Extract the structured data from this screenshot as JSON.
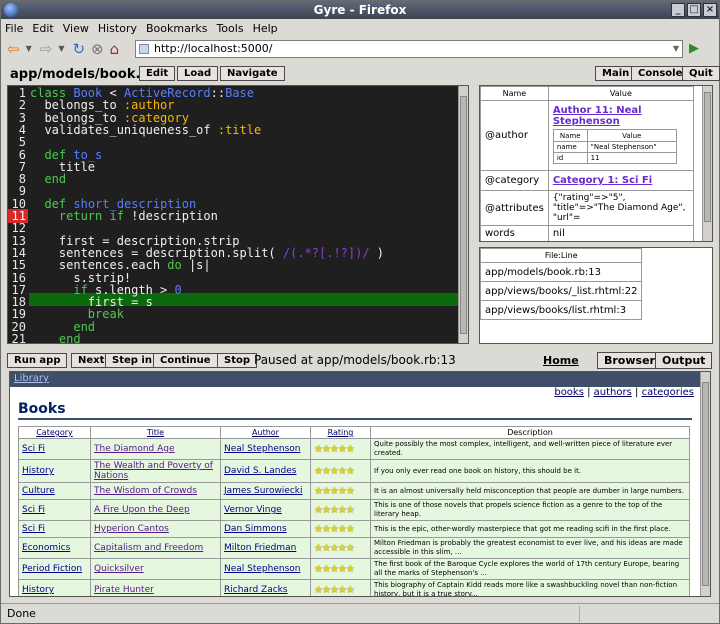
{
  "window": {
    "title": "Gyre - Firefox"
  },
  "menu": [
    "File",
    "Edit",
    "View",
    "History",
    "Bookmarks",
    "Tools",
    "Help"
  ],
  "nav": {
    "url": "http://localhost:5000/"
  },
  "editor": {
    "filename": "app/models/book.rb",
    "edit_label": "Edit",
    "load_label": "Load",
    "navigate_label": "Navigate",
    "main_label": "Main",
    "console_label": "Console",
    "quit_label": "Quit",
    "line_numbers": [
      "1",
      "2",
      "3",
      "4",
      "5",
      "6",
      "7",
      "8",
      "9",
      "10",
      "11",
      "12",
      "13",
      "14",
      "15",
      "16",
      "17",
      "18",
      "19",
      "20",
      "21"
    ],
    "breakpoint_line": 11,
    "current_line": 13
  },
  "variables": {
    "col_name": "Name",
    "col_value": "Value",
    "rows": [
      {
        "name": "@author",
        "value": "Author 11: Neal Stephenson"
      },
      {
        "name": "@category",
        "value": "Category 1: Sci Fi"
      },
      {
        "name": "@attributes",
        "value": "{\"rating\"=>\"5\", \"title\"=>\"The Diamond Age\", \"url\"="
      },
      {
        "name": "words",
        "value": "nil"
      }
    ],
    "author_sub": {
      "col_name": "Name",
      "col_value": "Value",
      "rows": [
        {
          "name": "name",
          "value": "\"Neal Stephenson\""
        },
        {
          "name": "id",
          "value": "11"
        }
      ]
    }
  },
  "stack": {
    "header": "File:Line",
    "frames": [
      "app/models/book.rb:13",
      "app/views/books/_list.rhtml:22",
      "app/views/books/list.rhtml:3"
    ]
  },
  "controls": {
    "run_app": "Run app",
    "next": "Next",
    "step_in": "Step in",
    "continue": "Continue",
    "stop": "Stop",
    "paused_text": "Paused at app/models/book.rb:13",
    "home": "Home",
    "browser": "Browser",
    "output": "Output"
  },
  "page": {
    "library_link": "Library",
    "top_links": [
      "books",
      "authors",
      "categories"
    ],
    "heading": "Books",
    "columns": [
      "Category",
      "Title",
      "Author",
      "Rating",
      "Description"
    ],
    "books": [
      {
        "category": "Sci Fi",
        "title": "The Diamond Age",
        "author": "Neal Stephenson",
        "rating": 5,
        "desc": "Quite possibly the most complex, intelligent, and well-written piece of literature ever created."
      },
      {
        "category": "History",
        "title": "The Wealth and Poverty of Nations",
        "author": "David S. Landes",
        "rating": 5,
        "desc": "If you only ever read one book on history, this should be it."
      },
      {
        "category": "Culture",
        "title": "The Wisdom of Crowds",
        "author": "James Surowiecki",
        "rating": 5,
        "desc": "It is an almost universally held misconception that people are dumber in large numbers."
      },
      {
        "category": "Sci Fi",
        "title": "A Fire Upon the Deep",
        "author": "Vernor Vinge",
        "rating": 5,
        "desc": "This is one of those novels that propels science fiction as a genre to the top of the literary heap."
      },
      {
        "category": "Sci Fi",
        "title": "Hyperion Cantos",
        "author": "Dan Simmons",
        "rating": 5,
        "desc": "This is the epic, other-wordly masterpiece that got me reading scifi in the first place."
      },
      {
        "category": "Economics",
        "title": "Capitalism and Freedom",
        "author": "Milton Friedman",
        "rating": 5,
        "desc": "Milton Friedman is probably the greatest economist to ever live, and his ideas are made accessible in this slim, ..."
      },
      {
        "category": "Period Fiction",
        "title": "Quicksilver",
        "author": "Neal Stephenson",
        "rating": 5,
        "desc": "The first book of the Baroque Cycle explores the world of 17th century Europe, bearing all the marks of Stephenson's ..."
      },
      {
        "category": "History",
        "title": "Pirate Hunter",
        "author": "Richard Zacks",
        "rating": 5,
        "desc": "This biography of Captain Kidd reads more like a swashbuckling novel than non-fiction history, but it is a true story..."
      }
    ]
  },
  "status": {
    "text": "Done"
  }
}
